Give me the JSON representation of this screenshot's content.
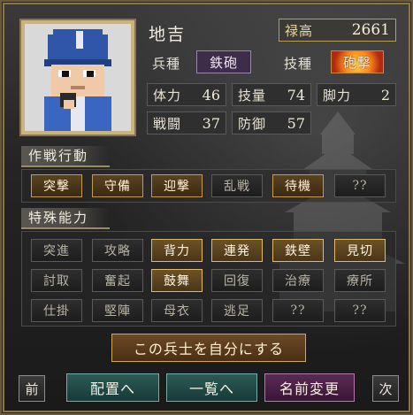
{
  "unit": {
    "name": "地吉",
    "koku_label": "禄高",
    "koku_value": "2661",
    "troop_type_label": "兵種",
    "troop_type_value": "鉄砲",
    "skill_label": "技種",
    "skill_value": "砲撃",
    "stats": [
      {
        "label": "体力",
        "value": "46"
      },
      {
        "label": "技量",
        "value": "74"
      },
      {
        "label": "脚力",
        "value": "2"
      },
      {
        "label": "戦闘",
        "value": "37"
      },
      {
        "label": "防御",
        "value": "57"
      }
    ]
  },
  "tactics": {
    "header": "作戦行動",
    "buttons": [
      {
        "label": "突撃",
        "state": "available"
      },
      {
        "label": "守備",
        "state": "available"
      },
      {
        "label": "迎撃",
        "state": "available"
      },
      {
        "label": "乱戦",
        "state": "unavailable"
      },
      {
        "label": "待機",
        "state": "available"
      },
      {
        "label": "??",
        "state": "unavailable"
      }
    ]
  },
  "abilities": {
    "header": "特殊能力",
    "buttons": [
      {
        "label": "突進",
        "state": "unavailable"
      },
      {
        "label": "攻略",
        "state": "unavailable"
      },
      {
        "label": "背力",
        "state": "learned"
      },
      {
        "label": "連発",
        "state": "learned"
      },
      {
        "label": "鉄壁",
        "state": "learned"
      },
      {
        "label": "見切",
        "state": "learned"
      },
      {
        "label": "討取",
        "state": "unavailable"
      },
      {
        "label": "奮起",
        "state": "unavailable"
      },
      {
        "label": "鼓舞",
        "state": "learned"
      },
      {
        "label": "回復",
        "state": "unavailable"
      },
      {
        "label": "治療",
        "state": "unavailable"
      },
      {
        "label": "療所",
        "state": "unavailable"
      },
      {
        "label": "仕掛",
        "state": "unavailable"
      },
      {
        "label": "堅陣",
        "state": "unavailable"
      },
      {
        "label": "母衣",
        "state": "unavailable"
      },
      {
        "label": "逃足",
        "state": "unavailable"
      },
      {
        "label": "??",
        "state": "unavailable"
      },
      {
        "label": "??",
        "state": "unavailable"
      }
    ]
  },
  "actions": {
    "claim_label": "この兵士を自分にする",
    "prev_label": "前",
    "next_label": "次",
    "deploy_label": "配置へ",
    "list_label": "一覧へ",
    "rename_label": "名前変更"
  },
  "colors": {
    "gold_border": "#c49a52",
    "teal_button": "#2d5a55",
    "purple_button": "#5a2a55",
    "troop_badge": "#3d2c4a"
  }
}
